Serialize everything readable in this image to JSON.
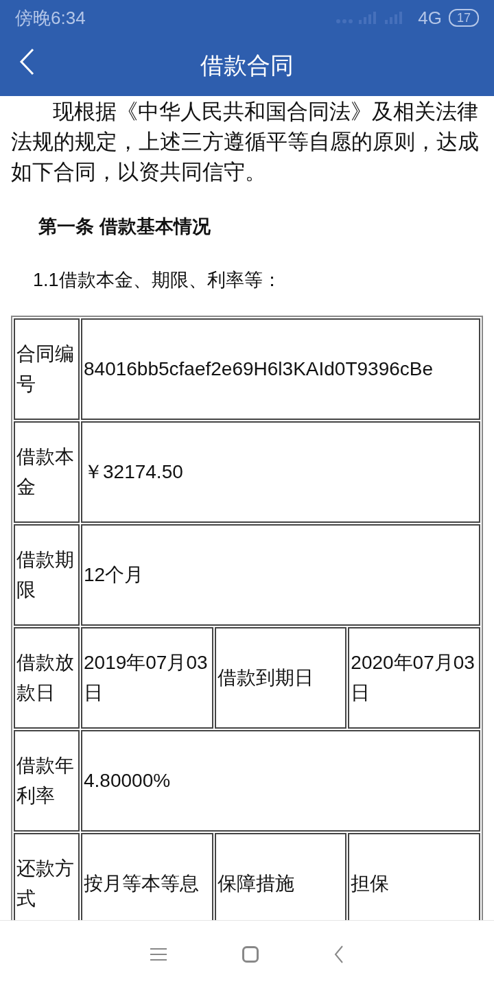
{
  "status_bar": {
    "time": "傍晚6:34",
    "network": "4G",
    "battery": "17"
  },
  "header": {
    "title": "借款合同"
  },
  "intro": "现根据《中华人民共和国合同法》及相关法律法规的规定，上述三方遵循平等自愿的原则，达成如下合同，以资共同信守。",
  "section_title": "第一条 借款基本情况",
  "subsection": "1.1借款本金、期限、利率等：",
  "table": {
    "rows": [
      {
        "cells": [
          {
            "text": "合同编号"
          },
          {
            "text": "84016bb5cfaef2e69H6l3KAId0T9396cBe",
            "colspan": 3
          }
        ]
      },
      {
        "cells": [
          {
            "text": "借款本金"
          },
          {
            "text": "￥32174.50",
            "colspan": 3
          }
        ]
      },
      {
        "cells": [
          {
            "text": "借款期限"
          },
          {
            "text": "12个月",
            "colspan": 3
          }
        ]
      },
      {
        "cells": [
          {
            "text": "借款放款日"
          },
          {
            "text": "2019年07月03日"
          },
          {
            "text": "借款到期日"
          },
          {
            "text": "2020年07月03日"
          }
        ]
      },
      {
        "cells": [
          {
            "text": "借款年利率"
          },
          {
            "text": "4.80000%",
            "colspan": 3
          }
        ]
      },
      {
        "cells": [
          {
            "text": "还款方式"
          },
          {
            "text": "按月等本等息"
          },
          {
            "text": "保障措施"
          },
          {
            "text": "担保"
          }
        ]
      }
    ]
  }
}
